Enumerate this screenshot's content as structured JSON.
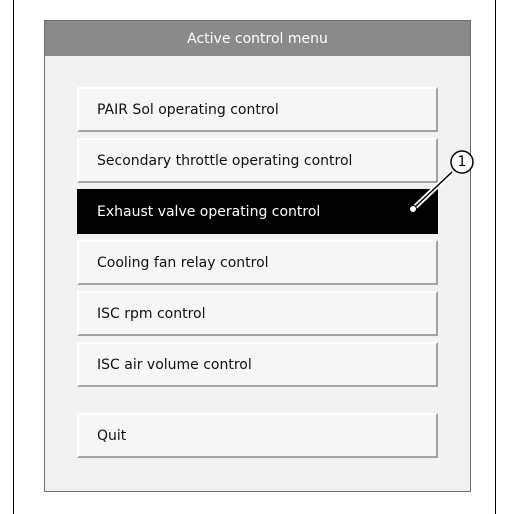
{
  "window": {
    "title": "Active control menu"
  },
  "menu": {
    "items": [
      {
        "label": "PAIR Sol operating control"
      },
      {
        "label": "Secondary throttle operating control"
      },
      {
        "label": "Exhaust valve operating control",
        "selected": true
      },
      {
        "label": "Cooling fan relay control"
      },
      {
        "label": "ISC rpm control"
      },
      {
        "label": "ISC air volume control"
      }
    ],
    "quit_label": "Quit"
  },
  "callout": {
    "number": "1"
  }
}
